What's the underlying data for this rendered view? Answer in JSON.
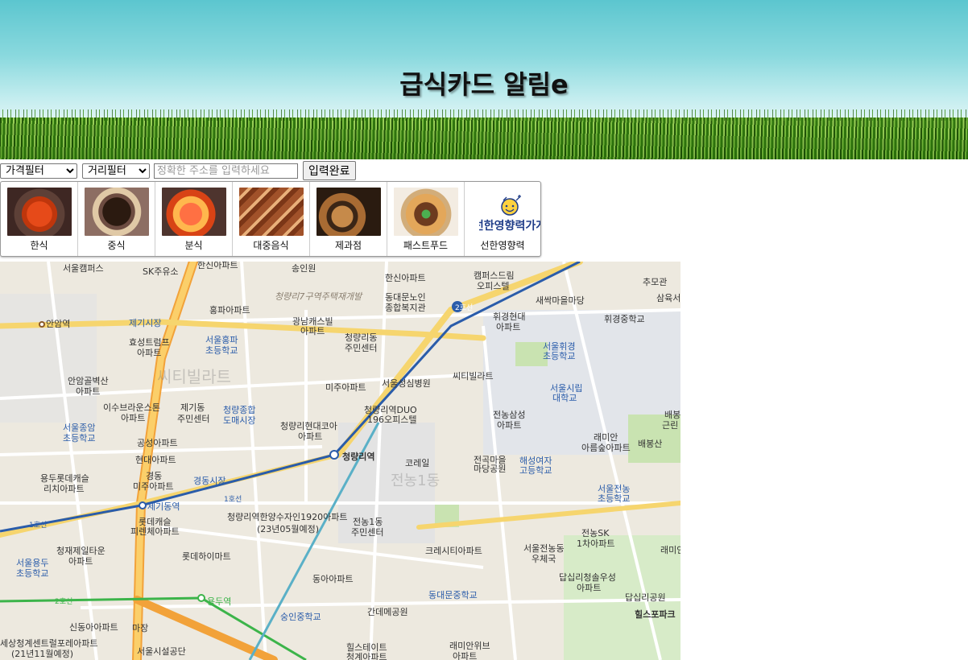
{
  "header": {
    "title": "급식카드 알림e"
  },
  "filters": {
    "price_label": "가격필터",
    "distance_label": "거리필터",
    "address_placeholder": "정확한 주소를 입력하세요",
    "address_value": "",
    "submit_label": "입력완료"
  },
  "categories": [
    {
      "label": "한식",
      "icon": "korean-food"
    },
    {
      "label": "중식",
      "icon": "chinese-food"
    },
    {
      "label": "분식",
      "icon": "snack-food"
    },
    {
      "label": "대중음식",
      "icon": "popular-food"
    },
    {
      "label": "제과점",
      "icon": "bakery"
    },
    {
      "label": "패스트푸드",
      "icon": "fast-food"
    },
    {
      "label": "선한영향력",
      "icon": "good-influence-logo"
    }
  ],
  "logo": {
    "text": "선한영향력가게"
  },
  "map": {
    "labels": [
      "서울캠퍼스",
      "SK주유소",
      "한신아파트",
      "송인원",
      "캠퍼스드림",
      "오피스텔",
      "추모관",
      "삼육서",
      "청량리7구역주택재개발",
      "한신아파트",
      "동대문노인",
      "종합복지관",
      "새싹마을마당",
      "안암역",
      "제기시장",
      "홍파아파트",
      "광남캐스빌",
      "아파트",
      "청량리동",
      "주민센터",
      "휘경현대",
      "아파트",
      "휘경중학교",
      "효성트럼프",
      "아파트",
      "서울홍파",
      "초등학교",
      "서울휘경",
      "초등학교",
      "제기동",
      "서울성심병원",
      "씨티빌라트",
      "안암골벽산",
      "아파트",
      "미주아파트",
      "서울시립",
      "대학교",
      "이수브라운스톤",
      "아파트",
      "제기동",
      "주민센터",
      "청량종합",
      "도매시장",
      "청량리역DUO",
      "196오피스텔",
      "청량리현대코아",
      "아파트",
      "전농삼성",
      "아파트",
      "배봉",
      "근린",
      "서울종암",
      "초등학교",
      "공성아파트",
      "래미안",
      "아름숲아파트",
      "배봉산",
      "현대아파트",
      "청량리역",
      "코레일",
      "전곡마을",
      "마당공원",
      "해성여자",
      "고등학교",
      "전농1동",
      "용두롯데캐슬",
      "리치아파트",
      "경동",
      "미주아파트",
      "경동시장",
      "서울전농",
      "초등학교",
      "제기동역",
      "1호선",
      "청량리역한양수자인1920아파트",
      "(23년05월예정)",
      "전농1동",
      "주민센터",
      "롯데캐슬",
      "피렌체아파트",
      "전농SK",
      "1차아파트",
      "청재제일타운",
      "아파트",
      "래미안",
      "크레시티아파트",
      "서울전농동",
      "우체국",
      "롯데하이마트",
      "서울용두",
      "초등학교",
      "동아아파트",
      "답십리청솔우성",
      "아파트",
      "2호선",
      "용두역",
      "동대문중학교",
      "숭인중학교",
      "간데메공원",
      "답십리공원",
      "신동아아파트",
      "마장",
      "힐스포파크",
      "세상청계센트럴포레아파트",
      "(21년11월예정)",
      "서울시설공단",
      "힐스테이트",
      "청계아파트",
      "래미안위브",
      "아파트",
      "1호선",
      "2호선",
      "6"
    ]
  }
}
